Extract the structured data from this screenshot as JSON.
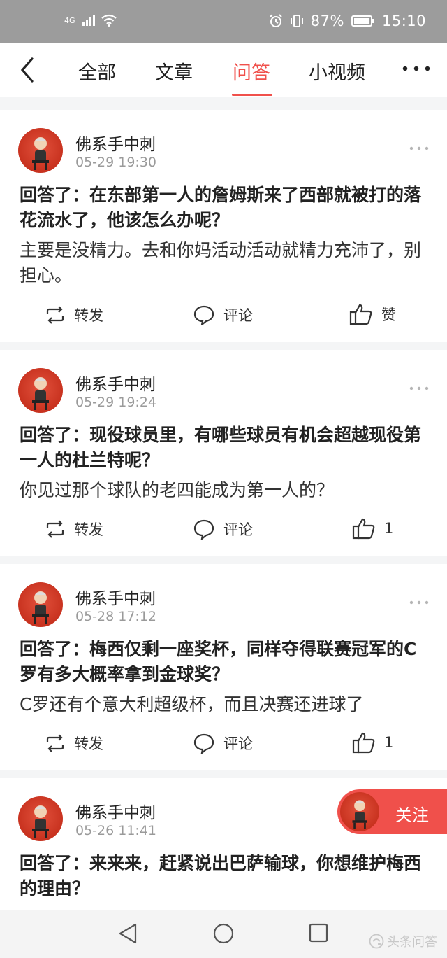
{
  "status_bar": {
    "network": "4G",
    "battery_percent": "87%",
    "time": "15:10"
  },
  "tabs": [
    {
      "label": "全部",
      "active": false
    },
    {
      "label": "文章",
      "active": false
    },
    {
      "label": "问答",
      "active": true
    },
    {
      "label": "小视频",
      "active": false
    }
  ],
  "colors": {
    "accent": "#f0504b",
    "muted": "#9a9a9a"
  },
  "feed": [
    {
      "author": "佛系手中刺",
      "timestamp": "05-29 19:30",
      "title": "回答了：在东部第一人的詹姆斯来了西部就被打的落花流水了，他该怎么办呢？",
      "answer": "主要是没精力。去和你妈活动活动就精力充沛了，别担心。",
      "repost_label": "转发",
      "comment_label": "评论",
      "like_label": "赞"
    },
    {
      "author": "佛系手中刺",
      "timestamp": "05-29 19:24",
      "title": "回答了：现役球员里，有哪些球员有机会超越现役第一人的杜兰特呢？",
      "answer": "你见过那个球队的老四能成为第一人的？",
      "repost_label": "转发",
      "comment_label": "评论",
      "like_label": "1"
    },
    {
      "author": "佛系手中刺",
      "timestamp": "05-28 17:12",
      "title": "回答了：梅西仅剩一座奖杯，同样夺得联赛冠军的C罗有多大概率拿到金球奖？",
      "answer": "C罗还有个意大利超级杯，而且决赛还进球了",
      "repost_label": "转发",
      "comment_label": "评论",
      "like_label": "1"
    },
    {
      "author": "佛系手中刺",
      "timestamp": "05-26 11:41",
      "title": "回答了：来来来，赶紧说出巴萨输球，你想维护梅西的理由？"
    }
  ],
  "follow_button": {
    "label": "关注"
  },
  "watermark": "头条问答",
  "icons": {
    "back": "chevron-left-icon",
    "more": "more-dots-icon",
    "repost": "repost-icon",
    "comment": "comment-bubble-icon",
    "like": "thumbs-up-icon",
    "nav_back": "triangle-back-icon",
    "nav_home": "circle-home-icon",
    "nav_recent": "square-recent-icon"
  }
}
